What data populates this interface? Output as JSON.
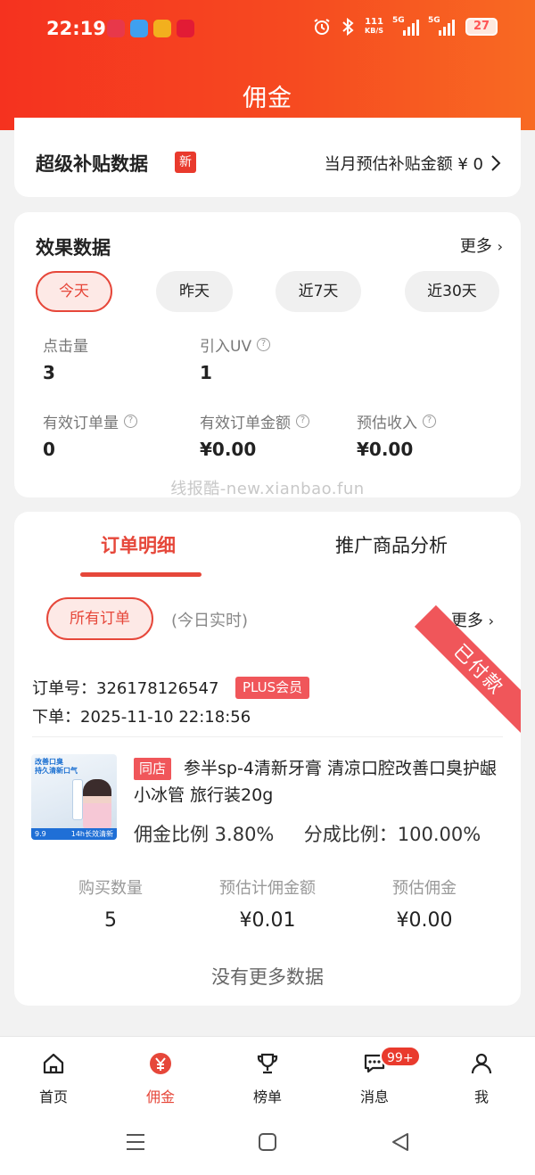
{
  "status_bar": {
    "time": "22:19",
    "net_speed_value": "111",
    "net_speed_unit": "KB/S",
    "signal_1_label": "5G",
    "signal_2_label": "5G",
    "battery": "27"
  },
  "header": {
    "title": "佣金"
  },
  "subsidy": {
    "title": "超级补贴数据",
    "new_badge": "新",
    "estimate_label": "当月预估补贴金额 ¥ 0"
  },
  "effect": {
    "title": "效果数据",
    "more": "更多",
    "chips": [
      "今天",
      "昨天",
      "近7天",
      "近30天"
    ],
    "active_chip_index": 0,
    "metrics": {
      "clicks": {
        "label": "点击量",
        "value": "3"
      },
      "uv": {
        "label": "引入UV",
        "value": "1"
      },
      "valid_orders": {
        "label": "有效订单量",
        "value": "0"
      },
      "valid_amount": {
        "label": "有效订单金额",
        "value": "¥0.00"
      },
      "est_income": {
        "label": "预估收入",
        "value": "¥0.00"
      }
    },
    "watermark": "线报酷-new.xianbao.fun"
  },
  "orders": {
    "tabs": [
      "订单明细",
      "推广商品分析"
    ],
    "active_tab_index": 0,
    "filter": "所有订单",
    "realtime_note": "(今日实时)",
    "more": "更多",
    "order": {
      "status_ribbon": "已付款",
      "order_no": "订单号：326178126547",
      "member_badge": "PLUS会员",
      "order_time": "下单：2025-11-10 22:18:56",
      "store_badge": "同店",
      "product_title": "参半sp-4清新牙膏 清凉口腔改善口臭护龈小冰管 旅行装20g",
      "product_image_text": {
        "headline_1": "改善口臭",
        "headline_2": "持久清新口气",
        "price": "9.9",
        "tagline": "14h长效清新"
      },
      "commission_rate": "佣金比例 3.80%",
      "split_rate": "分成比例：100.00%",
      "stats": [
        {
          "label": "购买数量",
          "value": "5"
        },
        {
          "label": "预估计佣金额",
          "value": "¥0.01"
        },
        {
          "label": "预估佣金",
          "value": "¥0.00"
        }
      ]
    },
    "no_more": "没有更多数据"
  },
  "bottom_nav": {
    "items": [
      "首页",
      "佣金",
      "榜单",
      "消息",
      "我"
    ],
    "active_index": 1,
    "message_badge": "99+"
  },
  "colors": {
    "brand_red": "#e6473a",
    "header_gradient_start": "#f5321f",
    "header_gradient_end": "#f86a22",
    "ribbon": "#f0565a"
  }
}
